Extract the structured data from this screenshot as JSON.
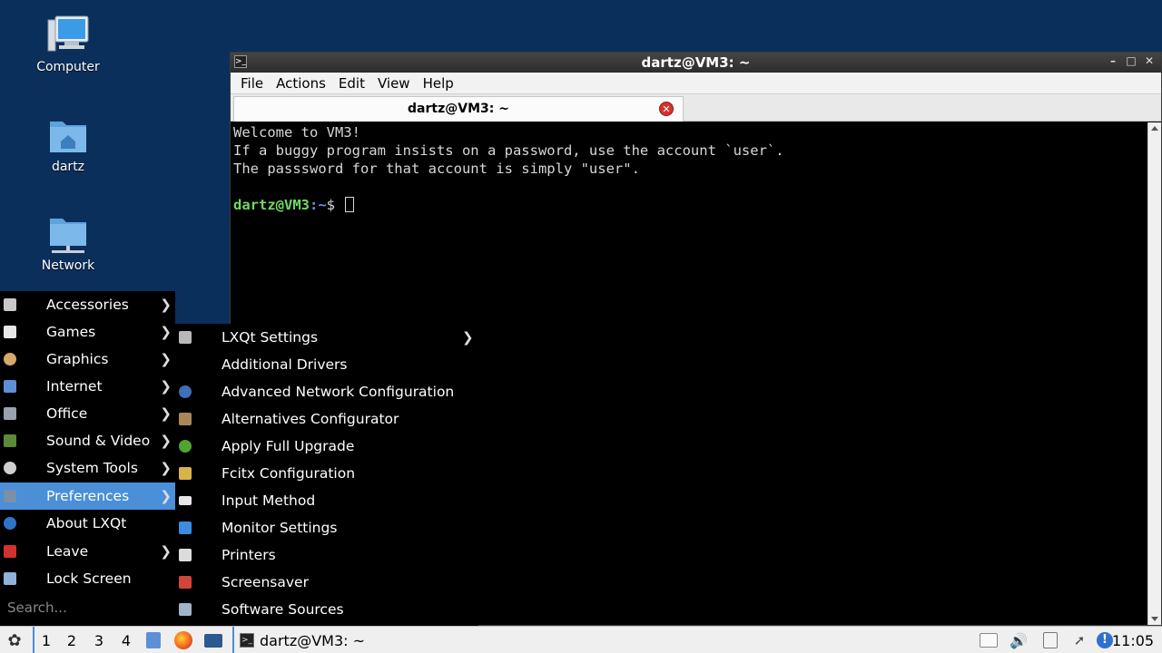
{
  "desktop": {
    "icons": [
      {
        "label": "Computer"
      },
      {
        "label": "dartz"
      },
      {
        "label": "Network"
      }
    ]
  },
  "terminal": {
    "window_title": "dartz@VM3: ~",
    "menu": [
      "File",
      "Actions",
      "Edit",
      "View",
      "Help"
    ],
    "tab_label": "dartz@VM3: ~",
    "lines": [
      "Welcome to VM3!",
      "If a buggy program insists on a password, use the account `user`.",
      "The passsword for that account is simply \"user\"."
    ],
    "prompt_user": "dartz@VM3",
    "prompt_path": ":~",
    "prompt_symbol": "$ "
  },
  "main_menu": {
    "items": [
      {
        "label": "Accessories",
        "has_submenu": true
      },
      {
        "label": "Games",
        "has_submenu": true
      },
      {
        "label": "Graphics",
        "has_submenu": true
      },
      {
        "label": "Internet",
        "has_submenu": true
      },
      {
        "label": "Office",
        "has_submenu": true
      },
      {
        "label": "Sound & Video",
        "has_submenu": true
      },
      {
        "label": "System Tools",
        "has_submenu": true
      },
      {
        "label": "Preferences",
        "has_submenu": true,
        "active": true
      },
      {
        "label": "About LXQt",
        "has_submenu": false
      },
      {
        "label": "Leave",
        "has_submenu": true
      },
      {
        "label": "Lock Screen",
        "has_submenu": false
      }
    ],
    "search_placeholder": "Search..."
  },
  "preferences_menu": {
    "items": [
      {
        "label": "LXQt Settings",
        "has_submenu": true
      },
      {
        "label": "Additional Drivers"
      },
      {
        "label": "Advanced Network Configuration"
      },
      {
        "label": "Alternatives Configurator"
      },
      {
        "label": "Apply Full Upgrade"
      },
      {
        "label": "Fcitx Configuration"
      },
      {
        "label": "Input Method"
      },
      {
        "label": "Monitor Settings"
      },
      {
        "label": "Printers"
      },
      {
        "label": "Screensaver"
      },
      {
        "label": "Software Sources"
      }
    ]
  },
  "taskbar": {
    "desktops": [
      "1",
      "2",
      "3",
      "4"
    ],
    "task_label": "dartz@VM3: ~",
    "clock": "11:05"
  },
  "colors": {
    "desktop_bg": "#0b2f5b",
    "menu_highlight": "#4a8fd8",
    "prompt_user": "#6fdc5f",
    "prompt_path": "#6f8fe8"
  }
}
